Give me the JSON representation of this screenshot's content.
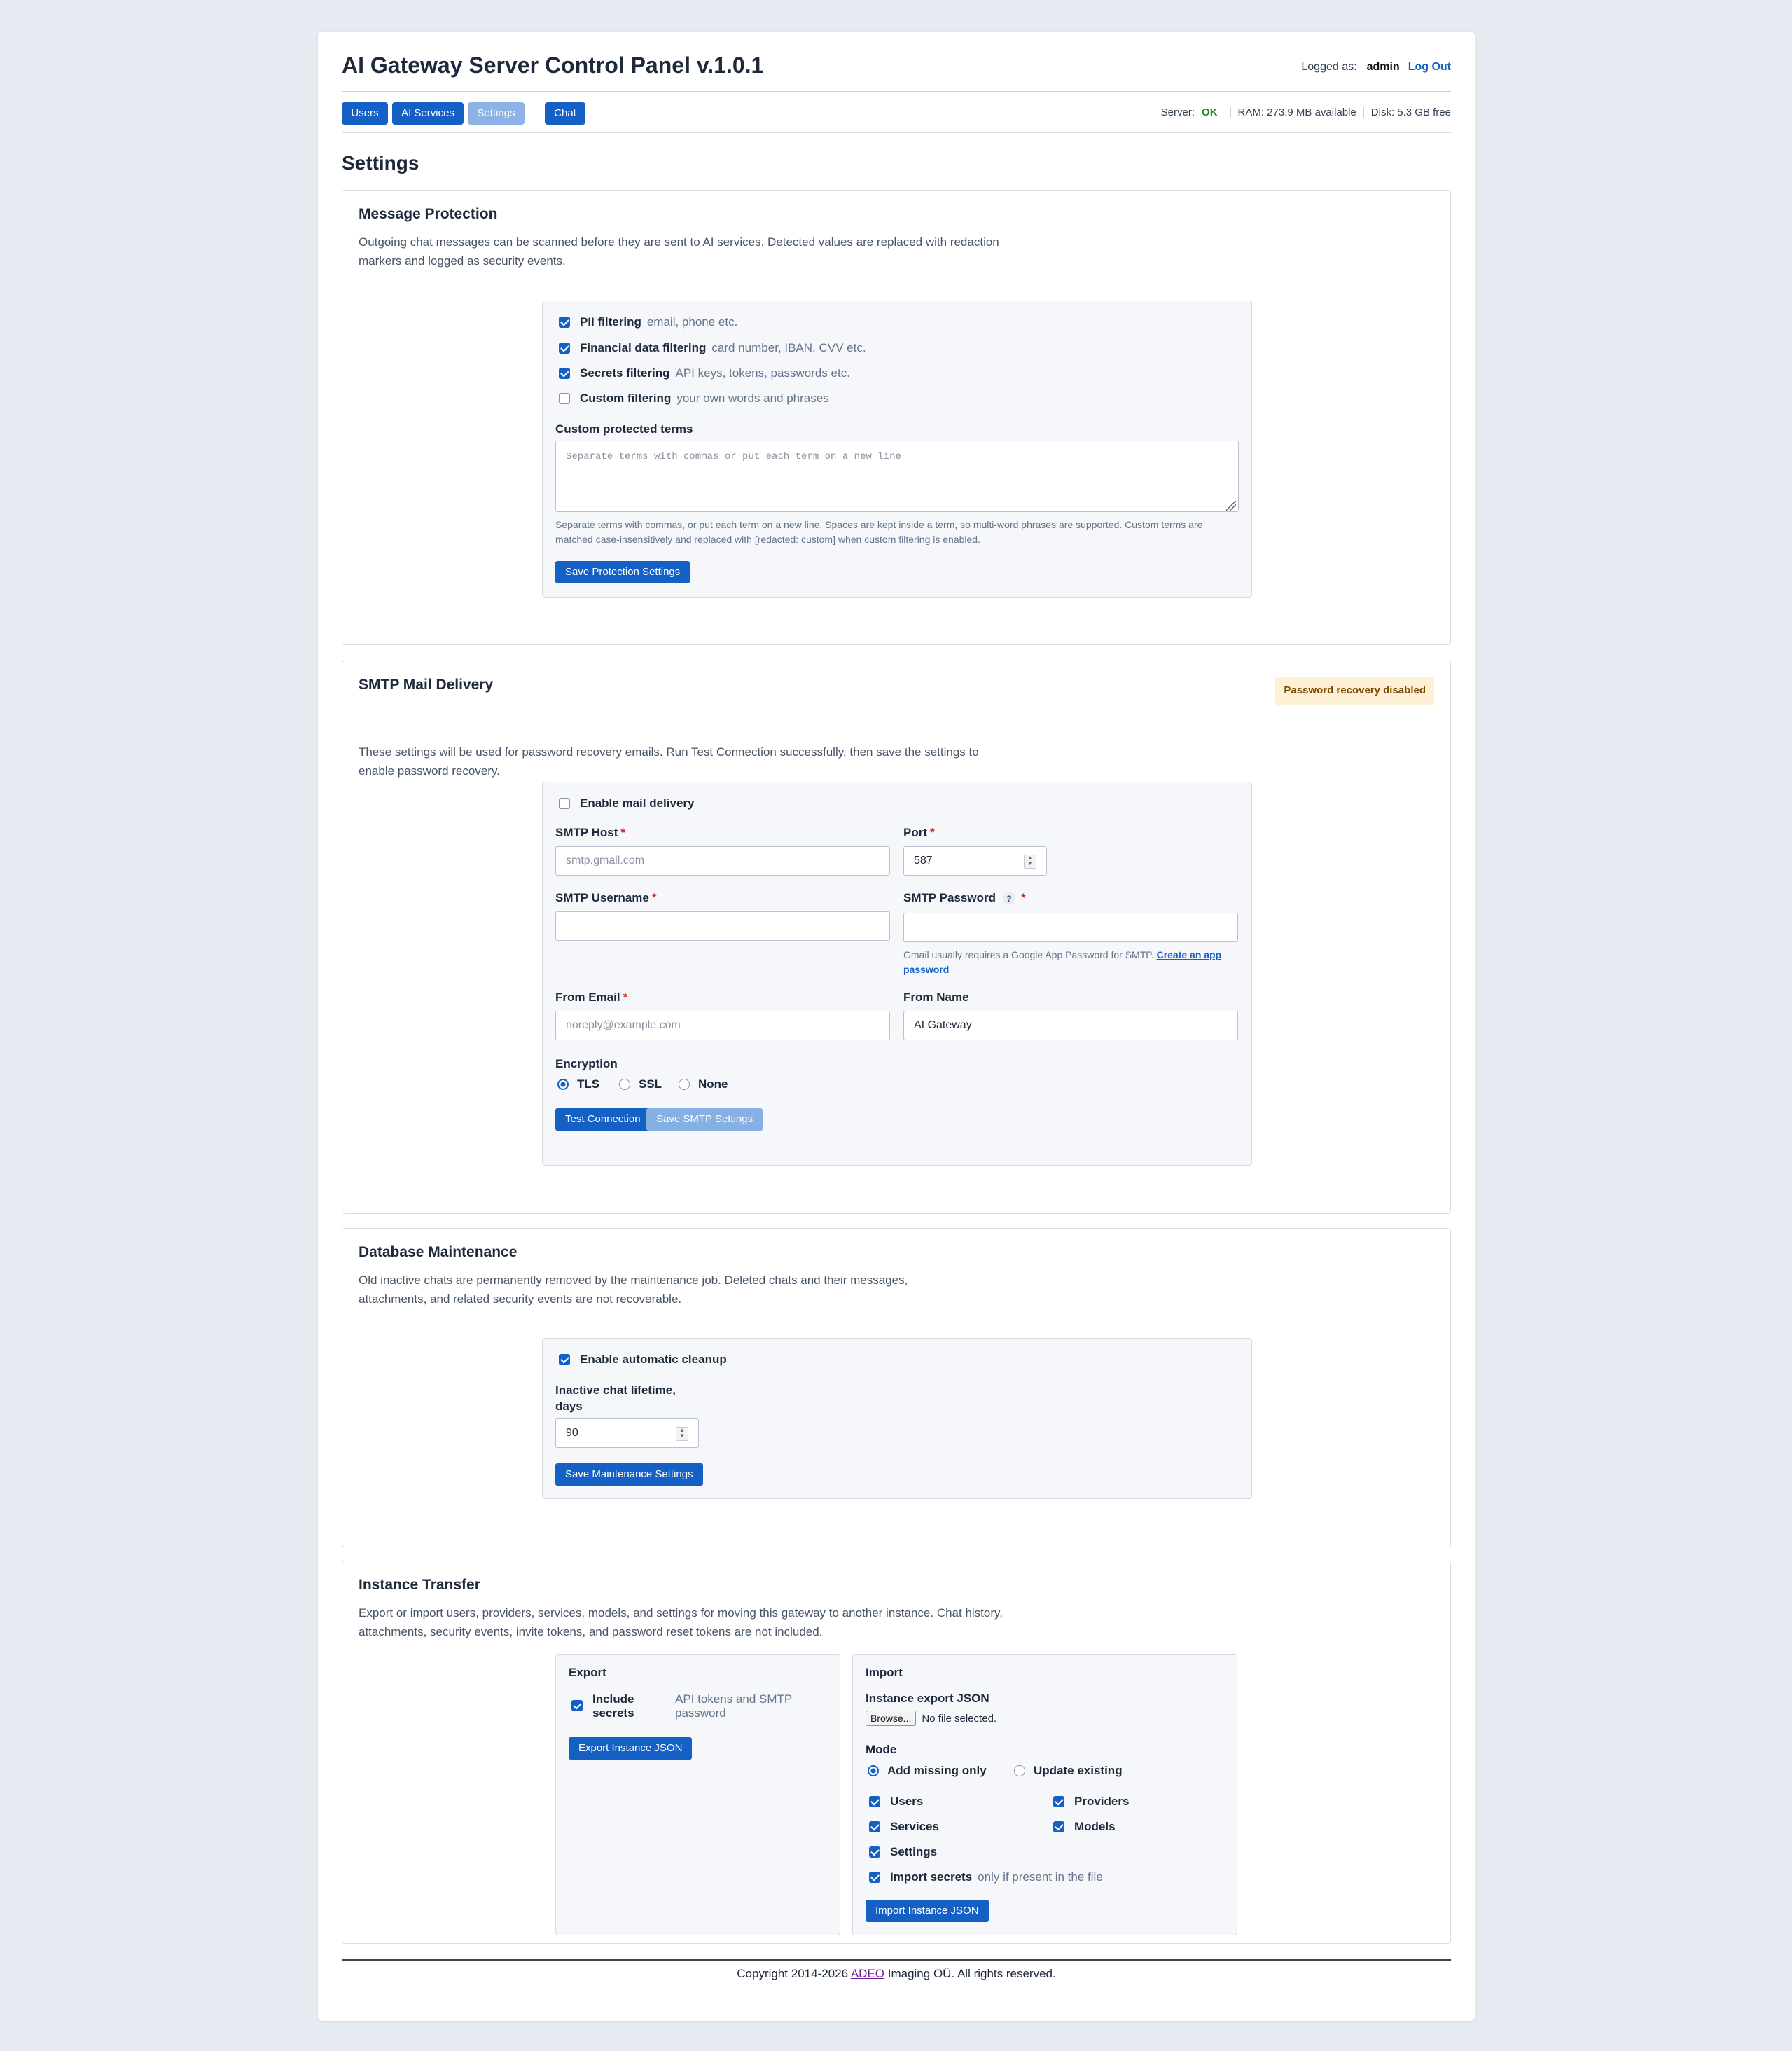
{
  "header": {
    "title": "AI Gateway Server Control Panel v.1.0.1",
    "logged_as_label": "Logged as:",
    "username": "admin",
    "logout": "Log Out"
  },
  "nav": {
    "tabs": [
      {
        "label": "Users",
        "active": false
      },
      {
        "label": "AI Services",
        "active": false
      },
      {
        "label": "Settings",
        "active": true
      },
      {
        "label": "Chat",
        "active": false
      }
    ]
  },
  "status": {
    "server_label": "Server:",
    "server_value": "OK",
    "ram": "RAM: 273.9 MB available",
    "disk": "Disk: 5.3 GB free"
  },
  "page_title": "Settings",
  "message_protection": {
    "title": "Message Protection",
    "description": "Outgoing chat messages can be scanned before they are sent to AI services. Detected values are replaced with redaction markers and logged as security events.",
    "filters": [
      {
        "label": "PII filtering",
        "hint": "email, phone etc.",
        "checked": true
      },
      {
        "label": "Financial data filtering",
        "hint": "card number, IBAN, CVV etc.",
        "checked": true
      },
      {
        "label": "Secrets filtering",
        "hint": "API keys, tokens, passwords etc.",
        "checked": true
      },
      {
        "label": "Custom filtering",
        "hint": "your own words and phrases",
        "checked": false
      }
    ],
    "custom_terms_label": "Custom protected terms",
    "custom_terms_placeholder": "Separate terms with commas or put each term on a new line",
    "help_text": "Separate terms with commas, or put each term on a new line. Spaces are kept inside a term, so multi-word phrases are supported. Custom terms are matched case-insensitively and replaced with [redacted: custom] when custom filtering is enabled.",
    "save_button": "Save Protection Settings"
  },
  "smtp": {
    "title": "SMTP Mail Delivery",
    "badge": "Password recovery disabled",
    "description": "These settings will be used for password recovery emails. Run Test Connection successfully, then save the settings to enable password recovery.",
    "enable_label": "Enable mail delivery",
    "enable_checked": false,
    "host_label": "SMTP Host",
    "host_placeholder": "smtp.gmail.com",
    "port_label": "Port",
    "port_value": "587",
    "username_label": "SMTP Username",
    "username_value": "",
    "password_label": "SMTP Password",
    "password_help_icon": "?",
    "password_value": "",
    "password_hint": "Gmail usually requires a Google App Password for SMTP.",
    "password_hint_link": "Create an app password",
    "from_email_label": "From Email",
    "from_email_placeholder": "noreply@example.com",
    "from_name_label": "From Name",
    "from_name_value": "AI Gateway",
    "encryption_label": "Encryption",
    "encryption_options": [
      {
        "label": "TLS",
        "selected": true
      },
      {
        "label": "SSL",
        "selected": false
      },
      {
        "label": "None",
        "selected": false
      }
    ],
    "required_mark": "*",
    "test_button": "Test Connection",
    "save_button": "Save SMTP Settings"
  },
  "maintenance": {
    "title": "Database Maintenance",
    "description": "Old inactive chats are permanently removed by the maintenance job. Deleted chats and their messages, attachments, and related security events are not recoverable.",
    "enable_label": "Enable automatic cleanup",
    "enable_checked": true,
    "lifetime_label_line1": "Inactive chat lifetime,",
    "lifetime_label_line2": "days",
    "lifetime_value": "90",
    "save_button": "Save Maintenance Settings"
  },
  "transfer": {
    "title": "Instance Transfer",
    "description": "Export or import users, providers, services, models, and settings for moving this gateway to another instance. Chat history, attachments, security events, invite tokens, and password reset tokens are not included.",
    "export": {
      "title": "Export",
      "include_secrets_line1": "Include",
      "include_secrets_line2": "secrets",
      "include_secrets_hint": "API tokens and SMTP password",
      "include_secrets_checked": true,
      "button": "Export Instance JSON"
    },
    "import": {
      "title": "Import",
      "file_label": "Instance export JSON",
      "browse_button": "Browse...",
      "file_status": "No file selected.",
      "mode_label": "Mode",
      "modes": [
        {
          "label": "Add missing only",
          "selected": true
        },
        {
          "label": "Update existing",
          "selected": false
        }
      ],
      "entities": [
        {
          "label": "Users",
          "checked": true
        },
        {
          "label": "Providers",
          "checked": true
        },
        {
          "label": "Services",
          "checked": true
        },
        {
          "label": "Models",
          "checked": true
        },
        {
          "label": "Settings",
          "checked": true
        }
      ],
      "import_secrets_label": "Import secrets",
      "import_secrets_hint": "only if present in the file",
      "import_secrets_checked": true,
      "button": "Import Instance JSON"
    }
  },
  "footer": {
    "prefix": "Copyright 2014-2026 ",
    "company_link": "ADEO",
    "suffix": " Imaging OÜ. All rights reserved."
  },
  "colors": {
    "primary": "#1560c4",
    "ok": "#1b8a2e",
    "badge_bg": "#fdf0d5",
    "page_bg": "#e6eaf1"
  }
}
